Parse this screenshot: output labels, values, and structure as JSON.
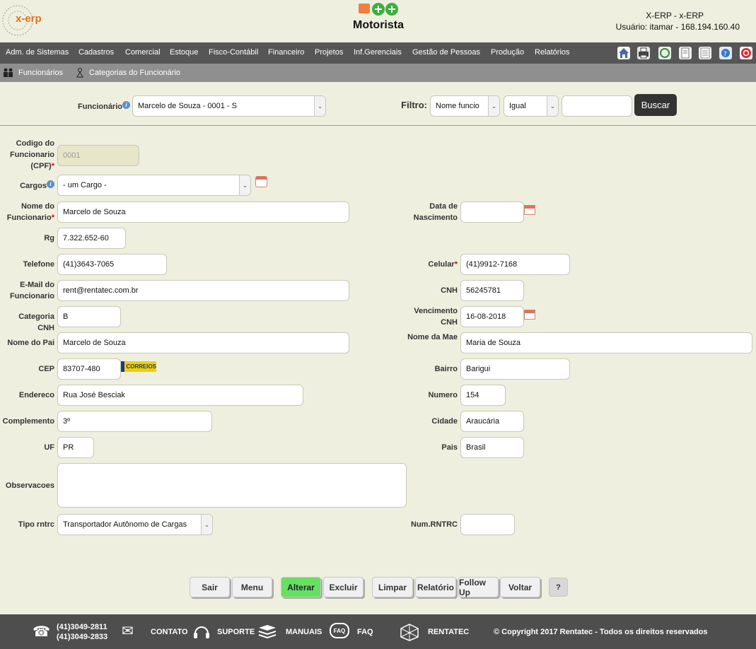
{
  "header": {
    "logo_text": "x-erp",
    "page_title": "Motorista",
    "system_name": "X-ERP - x-ERP",
    "user_info": "Usuário: itamar - 168.194.160.40"
  },
  "menu": {
    "items": [
      "Adm. de Sistemas",
      "Cadastros",
      "Comercial",
      "Estoque",
      "Fisco-Contábil",
      "Financeiro",
      "Projetos",
      "Inf.Gerenciais",
      "Gestão de Pessoas",
      "Produção",
      "Relatórios"
    ],
    "toolbar_icons": [
      "home-icon",
      "printer-icon",
      "recycle-icon",
      "document-icon",
      "notepad-icon",
      "help-bubble-icon",
      "power-icon"
    ]
  },
  "submenu": {
    "items": [
      "Funcionários",
      "Categorias do Funcionário"
    ]
  },
  "filter": {
    "funcionario_label": "Funcionário",
    "funcionario_value": "Marcelo de Souza - 0001 - S",
    "filtro_label": "Filtro:",
    "field_value": "Nome funcio",
    "operator_value": "Igual",
    "search_value": "",
    "buscar_label": "Buscar"
  },
  "form": {
    "codigo_label": "Codigo do Funcionario (CPF)",
    "codigo_value": "0001",
    "cargos_label": "Cargos",
    "cargos_value": "- um Cargo -",
    "nome_label": "Nome do Funcionario",
    "nome_value": "Marcelo de Souza",
    "nascimento_label": "Data de Nascimento",
    "nascimento_value": "",
    "rg_label": "Rg",
    "rg_value": "7.322.652-60",
    "telefone_label": "Telefone",
    "telefone_value": "(41)3643-7065",
    "celular_label": "Celular",
    "celular_value": "(41)9912-7168",
    "email_label": "E-Mail do Funcionario",
    "email_value": "rent@rentatec.com.br",
    "cnh_label": "CNH",
    "cnh_value": "56245781",
    "categoria_cnh_label": "Categoria CNH",
    "categoria_cnh_value": "B",
    "vencimento_label": "Vencimento CNH",
    "vencimento_value": "16-08-2018",
    "pai_label": "Nome do Pai",
    "pai_value": "Marcelo de Souza",
    "mae_label": "Nome da Mae",
    "mae_value": "Maria de Souza",
    "cep_label": "CEP",
    "cep_value": "83707-480",
    "correios_label": "CORREIOS",
    "bairro_label": "Bairro",
    "bairro_value": "Barigui",
    "endereco_label": "Endereco",
    "endereco_value": "Rua José Besciak",
    "numero_label": "Numero",
    "numero_value": "154",
    "complemento_label": "Complemento",
    "complemento_value": "3º",
    "cidade_label": "Cidade",
    "cidade_value": "Araucária",
    "uf_label": "UF",
    "uf_value": "PR",
    "pais_label": "Pais",
    "pais_value": "Brasil",
    "observacoes_label": "Observacoes",
    "observacoes_value": "",
    "tipo_rntrc_label": "Tipo rntrc",
    "tipo_rntrc_value": "Transportador Autônomo de Cargas",
    "num_rntrc_label": "Num.RNTRC",
    "num_rntrc_value": ""
  },
  "buttons": {
    "sair": "Sair",
    "menu": "Menu",
    "alterar": "Alterar",
    "excluir": "Excluir",
    "limpar": "Limpar",
    "relatorio": "Relatório",
    "follow_up": "Follow Up",
    "voltar": "Voltar",
    "help": "?"
  },
  "footer": {
    "phone1": "(41)3049-2811",
    "phone2": "(41)3049-2833",
    "contato": "CONTATO",
    "suporte": "SUPORTE",
    "manuais": "MANUAIS",
    "faq_badge": "FAQ",
    "faq": "FAQ",
    "rentatec": "RENTATEC",
    "copyright": "© Copyright 2017 Rentatec - Todos os direitos reservados"
  },
  "colors": {
    "background": "#efefdf",
    "menubar": "#565656",
    "submenu": "#8f8f8f",
    "footer": "#4e4e4e",
    "alterar_button": "#66e060",
    "buscar_button": "#333333"
  }
}
